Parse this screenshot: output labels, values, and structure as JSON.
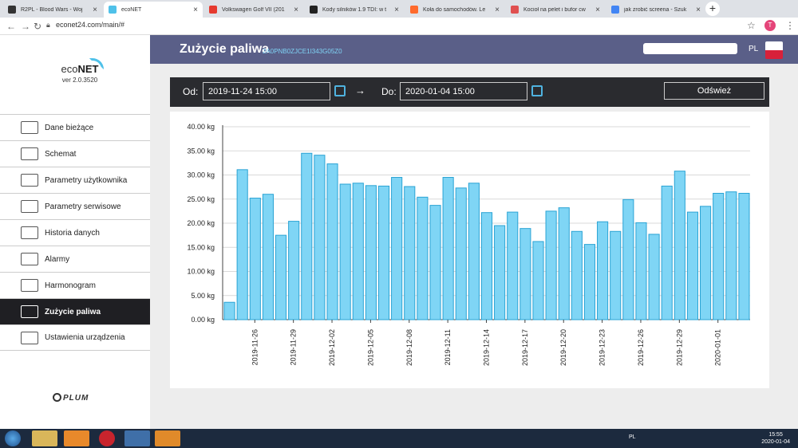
{
  "browser": {
    "tabs": [
      {
        "title": "R2PL - Blood Wars - Woj",
        "color": "#333333"
      },
      {
        "title": "ecoNET",
        "color": "#4fc1e9",
        "active": true
      },
      {
        "title": "Volkswagen Golf VII (201",
        "color": "#e63a2f"
      },
      {
        "title": "Kody silników 1.9 TDI: w t",
        "color": "#222222"
      },
      {
        "title": "Koła do samochodów. Le",
        "color": "#ff6a2c"
      },
      {
        "title": "Kocioł na pelet i bufor cw",
        "color": "#e05050"
      },
      {
        "title": "jak zrobić screena - Szuk",
        "color": "#4285f4"
      }
    ],
    "url": "econet24.com/main/#",
    "profile_initial": "T"
  },
  "sidebar": {
    "logo_eco": "eco",
    "logo_net": "NET",
    "version": "ver 2.0.3520",
    "items": [
      {
        "label": "Dane bieżące",
        "icon": "list-icon"
      },
      {
        "label": "Schemat",
        "icon": "schema-icon"
      },
      {
        "label": "Parametry użytkownika",
        "icon": "user-params-icon"
      },
      {
        "label": "Parametry serwisowe",
        "icon": "service-params-icon"
      },
      {
        "label": "Historia danych",
        "icon": "history-icon"
      },
      {
        "label": "Alarmy",
        "icon": "alarm-icon"
      },
      {
        "label": "Harmonogram",
        "icon": "schedule-icon"
      },
      {
        "label": "Zużycie paliwa",
        "icon": "fuel-usage-icon",
        "active": true
      },
      {
        "label": "Ustawienia urządzenia",
        "icon": "settings-icon"
      }
    ],
    "brand": "PLUM"
  },
  "header": {
    "title": "Zużycie paliwa",
    "device_id": "2A0PNB0ZJCE1I343G05Z0",
    "lang": "PL"
  },
  "filter": {
    "from_label": "Od:",
    "from_value": "2019-11-24 15:00",
    "to_label": "Do:",
    "to_value": "2020-01-04 15:00",
    "arrow": "→",
    "refresh_label": "Odśwież"
  },
  "chart_data": {
    "type": "bar",
    "ylim": [
      0,
      40
    ],
    "y_tick_labels": [
      "0.00 kg",
      "5.00 kg",
      "10.00 kg",
      "15.00 kg",
      "20.00 kg",
      "25.00 kg",
      "30.00 kg",
      "35.00 kg",
      "40.00 kg"
    ],
    "y_ticks": [
      0,
      5,
      10,
      15,
      20,
      25,
      30,
      35,
      40
    ],
    "categories": [
      "2019-11-24",
      "2019-11-25",
      "2019-11-26",
      "2019-11-27",
      "2019-11-28",
      "2019-11-29",
      "2019-11-30",
      "2019-12-01",
      "2019-12-02",
      "2019-12-03",
      "2019-12-04",
      "2019-12-05",
      "2019-12-06",
      "2019-12-07",
      "2019-12-08",
      "2019-12-09",
      "2019-12-10",
      "2019-12-11",
      "2019-12-12",
      "2019-12-13",
      "2019-12-14",
      "2019-12-15",
      "2019-12-16",
      "2019-12-17",
      "2019-12-18",
      "2019-12-19",
      "2019-12-20",
      "2019-12-21",
      "2019-12-22",
      "2019-12-23",
      "2019-12-24",
      "2019-12-25",
      "2019-12-26",
      "2019-12-27",
      "2019-12-28",
      "2019-12-29",
      "2019-12-30",
      "2019-12-31",
      "2020-01-01",
      "2020-01-02",
      "2020-01-03"
    ],
    "x_tick_labels": [
      "2019-11-26",
      "2019-11-29",
      "2019-12-02",
      "2019-12-05",
      "2019-12-08",
      "2019-12-11",
      "2019-12-14",
      "2019-12-17",
      "2019-12-20",
      "2019-12-23",
      "2019-12-26",
      "2019-12-29",
      "2020-01-01"
    ],
    "values": [
      3.6,
      31.1,
      25.2,
      26.0,
      17.5,
      20.4,
      34.5,
      34.1,
      32.3,
      28.1,
      28.3,
      27.8,
      27.7,
      29.5,
      27.6,
      25.4,
      23.7,
      29.5,
      27.3,
      28.3,
      22.2,
      19.5,
      22.3,
      18.9,
      16.2,
      22.5,
      23.2,
      18.3,
      15.6,
      20.3,
      18.3,
      24.9,
      20.1,
      17.7,
      27.7,
      30.8,
      22.3,
      23.5,
      26.2,
      26.5,
      26.2
    ],
    "grid": true,
    "legend": "none"
  },
  "taskbar": {
    "time": "15:55",
    "date": "2020-01-04",
    "lang": "PL",
    "apps": [
      "explorer-icon",
      "k-app-icon",
      "opera-icon",
      "chrome-icon",
      "media-icon"
    ]
  }
}
